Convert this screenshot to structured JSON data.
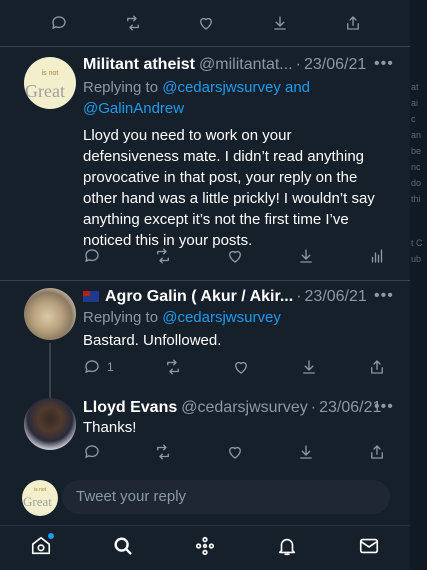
{
  "top_actions": [
    "reply",
    "retweet",
    "like",
    "download",
    "share"
  ],
  "tweets": [
    {
      "name": "Militant atheist",
      "handle": "@militantat...",
      "date": "23/06/21",
      "replying_prefix": "Replying to ",
      "replying_to_1": "@cedarsjwsurvey",
      "replying_and": " and",
      "replying_to_2": "@GalinAndrew",
      "lines": [
        "Lloyd you need to work on your",
        "defensiveness mate. I didn’t read anything",
        "provocative in that post, your reply on the",
        "other hand was a little prickly! I wouldn’t say",
        "anything except it’s not the first time I’ve",
        "noticed this in your posts."
      ],
      "avatar": {
        "small": "is not",
        "big": "Great"
      }
    },
    {
      "name": "Agro Galin ( Akur / Akir...",
      "handle": "",
      "date": "23/06/21",
      "replying_prefix": "Replying to ",
      "replying_to_1": "@cedarsjwsurvey",
      "text": "Bastard. Unfollowed.",
      "reply_count": "1"
    },
    {
      "name": "Lloyd Evans",
      "handle": "@cedarsjwsurvey",
      "date": "23/06/21",
      "text": "Thanks!"
    }
  ],
  "compose": {
    "placeholder": "Tweet your reply",
    "avatar_small": "is not",
    "avatar_big": "Great"
  },
  "more_glyph": "•••",
  "dot": "·",
  "right_strip": [
    "at",
    "ai",
    "c",
    "an",
    "be",
    "nc",
    "do",
    "thi",
    "t C",
    "ub"
  ],
  "nav": [
    "home-icon",
    "search-icon",
    "spaces-icon",
    "notifications-icon",
    "messages-icon"
  ],
  "colors": {
    "background": "#15202b",
    "link": "#1d9bf0",
    "muted": "#8b98a5",
    "divider": "#38444d"
  }
}
